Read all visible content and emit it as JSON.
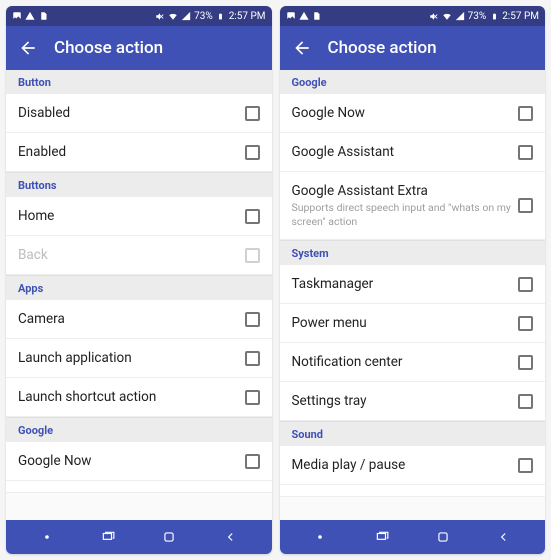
{
  "status": {
    "battery": "73%",
    "time": "2:57 PM"
  },
  "appbar": {
    "title": "Choose action"
  },
  "left": {
    "sections": [
      {
        "header": "Button",
        "items": [
          {
            "label": "Disabled"
          },
          {
            "label": "Enabled"
          }
        ]
      },
      {
        "header": "Buttons",
        "items": [
          {
            "label": "Home"
          },
          {
            "label": "Back",
            "disabled": true
          }
        ]
      },
      {
        "header": "Apps",
        "items": [
          {
            "label": "Camera"
          },
          {
            "label": "Launch application"
          },
          {
            "label": "Launch shortcut action"
          }
        ]
      },
      {
        "header": "Google",
        "items": [
          {
            "label": "Google Now"
          }
        ]
      }
    ]
  },
  "right": {
    "sections": [
      {
        "header": "Google",
        "items": [
          {
            "label": "Google Now"
          },
          {
            "label": "Google Assistant"
          },
          {
            "label": "Google Assistant Extra",
            "sub": "Supports direct speech input and \"whats on my screen\" action"
          }
        ]
      },
      {
        "header": "System",
        "items": [
          {
            "label": "Taskmanager"
          },
          {
            "label": "Power menu"
          },
          {
            "label": "Notification center"
          },
          {
            "label": "Settings tray"
          }
        ]
      },
      {
        "header": "Sound",
        "items": [
          {
            "label": "Media play / pause"
          }
        ]
      }
    ]
  }
}
